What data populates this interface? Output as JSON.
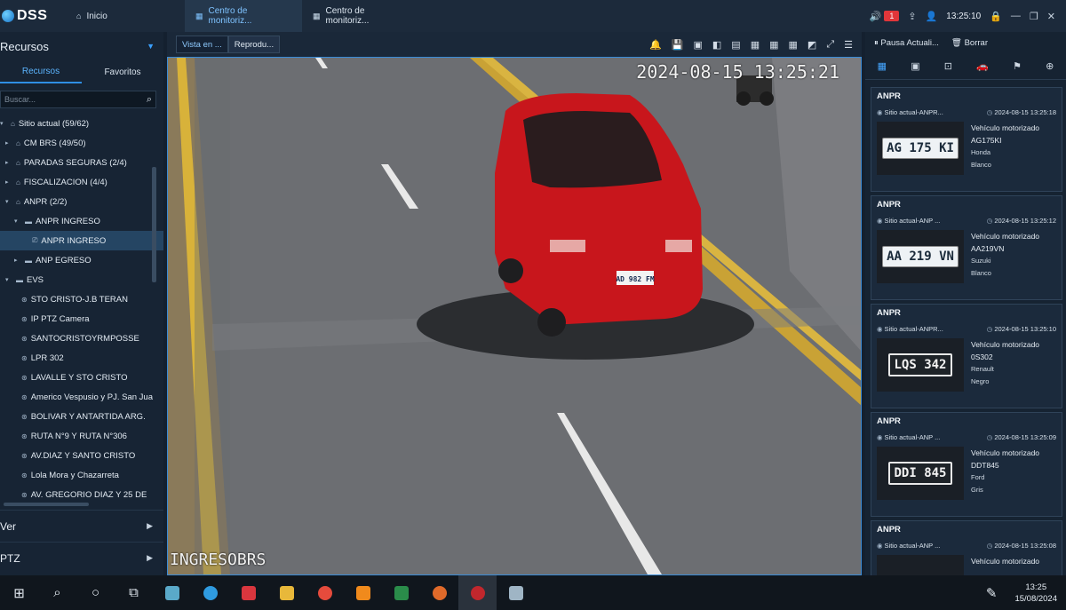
{
  "app": {
    "logo_text": "DSS"
  },
  "top_tabs": [
    {
      "label": "Inicio"
    },
    {
      "label": "Centro de monitoriz..."
    },
    {
      "label": "Centro de monitoriz..."
    }
  ],
  "top_right": {
    "alarm_count": "1",
    "time": "13:25:10"
  },
  "left": {
    "title": "Recursos",
    "tabs": [
      "Recursos",
      "Favoritos"
    ],
    "search_placeholder": "Buscar...",
    "tree": [
      {
        "label": "Sitio actual (59/62)"
      },
      {
        "label": "CM BRS (49/50)"
      },
      {
        "label": "PARADAS SEGURAS (2/4)"
      },
      {
        "label": "FISCALIZACION (4/4)"
      },
      {
        "label": "ANPR (2/2)"
      },
      {
        "label": "ANPR INGRESO"
      },
      {
        "label": "ANPR INGRESO"
      },
      {
        "label": "ANP EGRESO"
      },
      {
        "label": "EVS"
      },
      {
        "label": "STO CRISTO-J.B TERAN"
      },
      {
        "label": "IP PTZ Camera"
      },
      {
        "label": "SANTOCRISTOYRMPOSSE"
      },
      {
        "label": "LPR 302"
      },
      {
        "label": "LAVALLE Y STO CRISTO"
      },
      {
        "label": "Americo Vespusio y PJ. San Jua"
      },
      {
        "label": "BOLIVAR Y ANTARTIDA ARG."
      },
      {
        "label": "RUTA N°9 Y RUTA N°306"
      },
      {
        "label": "AV.DIAZ Y SANTO CRISTO"
      },
      {
        "label": "Lola Mora y Chazarreta"
      },
      {
        "label": "AV. GREGORIO DIAZ Y 25 DE"
      }
    ],
    "sections": [
      "Ver",
      "PTZ"
    ]
  },
  "center": {
    "view_tabs": [
      "Vista en ...",
      "Reprodu..."
    ],
    "osd_time": "2024-08-15 13:25:21",
    "osd_name": "INGRESOBRS",
    "car_plate": "AD 982 FM"
  },
  "right": {
    "pause_label": "Pausa Actuali...",
    "clear_label": "Borrar",
    "cards": [
      {
        "title": "ANPR",
        "site": "Sitio actual-ANPR...",
        "time": "2024-08-15 13:25:18",
        "type": "Vehículo motorizado",
        "plate_text": "AG175KI",
        "plate_img": "AG 175 KI",
        "brand": "Honda",
        "color": "Blanco"
      },
      {
        "title": "ANPR",
        "site": "Sitio actual-ANP ...",
        "time": "2024-08-15 13:25:12",
        "type": "Vehículo motorizado",
        "plate_text": "AA219VN",
        "plate_img": "AA 219 VN",
        "brand": "Suzuki",
        "color": "Blanco"
      },
      {
        "title": "ANPR",
        "site": "Sitio actual-ANPR...",
        "time": "2024-08-15 13:25:10",
        "type": "Vehículo motorizado",
        "plate_text": "0S302",
        "plate_img": "LQS 342",
        "brand": "Renault",
        "color": "Negro"
      },
      {
        "title": "ANPR",
        "site": "Sitio actual-ANP ...",
        "time": "2024-08-15 13:25:09",
        "type": "Vehículo motorizado",
        "plate_text": "DDT845",
        "plate_img": "DDI 845",
        "brand": "Ford",
        "color": "Gris"
      },
      {
        "title": "ANPR",
        "site": "Sitio actual-ANP ...",
        "time": "2024-08-15 13:25:08",
        "type": "Vehículo motorizado"
      }
    ]
  },
  "taskbar": {
    "time": "13:25",
    "date": "15/08/2024"
  }
}
